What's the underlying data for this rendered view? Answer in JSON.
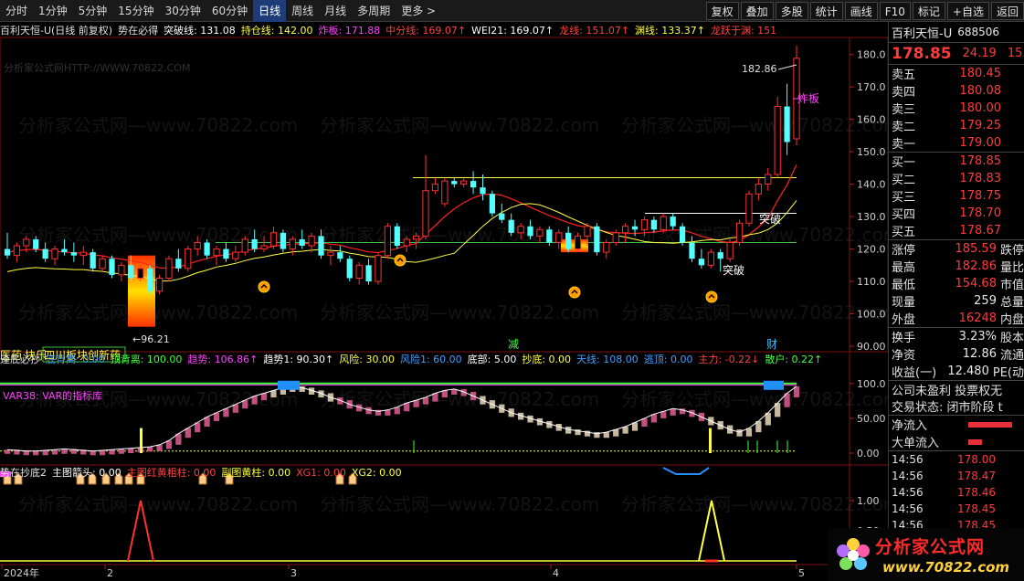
{
  "toolbar": {
    "periods": [
      "分时",
      "1分钟",
      "5分钟",
      "15分钟",
      "30分钟",
      "60分钟",
      "日线",
      "周线",
      "月线",
      "多周期",
      "更多 >"
    ],
    "active_period": "日线",
    "buttons": [
      "复权",
      "叠加",
      "多股",
      "统计",
      "画线",
      "F10",
      "标记",
      "+自选",
      "返回"
    ]
  },
  "main_header": {
    "stock": "百利天恒-U(日线 前复权)",
    "indicator": "势在必得",
    "items": [
      {
        "label": "突破线: 131.08",
        "color": "#ffffff"
      },
      {
        "label": "持仓线: 142.00",
        "color": "#ffff40"
      },
      {
        "label": "炸板: 171.88",
        "color": "#ff40ff"
      },
      {
        "label": "中分线: 169.07↑",
        "color": "#ff4040"
      },
      {
        "label": "WEI21: 169.07↑",
        "color": "#ffffff"
      },
      {
        "label": "龙线: 151.07↑",
        "color": "#ff4040"
      },
      {
        "label": "渊线: 133.37↑",
        "color": "#ffff40"
      },
      {
        "label": "龙跃于渊: 151",
        "color": "#ff4040"
      }
    ]
  },
  "price_axis": [
    "180.0",
    "170.0",
    "160.0",
    "150.0",
    "140.0",
    "130.0",
    "120.0",
    "110.0",
    "100.0",
    "90.00"
  ],
  "annotations": {
    "high_label": "182.86",
    "low_label": "96.21",
    "breakout1": "突破",
    "breakout2": "突破",
    "limit_break": "炸板",
    "sector1": "医药",
    "sector2": "块乐",
    "sector3": "四川板块创新药",
    "watermark": "分析家公式网",
    "watermark_url": "分析家公式网HTTP://WWW.70822.COM",
    "jian": "减",
    "cai": "财"
  },
  "sub1_header": {
    "name": "逢底必抄",
    "items": [
      {
        "label": "底背离: 0.00",
        "color": "#40a0ff"
      },
      {
        "label": "顶背离: 100.00",
        "color": "#40ff40"
      },
      {
        "label": "趋势: 106.86↑",
        "color": "#ff40ff"
      },
      {
        "label": "趋势1: 90.30↑",
        "color": "#ffffff"
      },
      {
        "label": "风险: 30.00",
        "color": "#ffff40"
      },
      {
        "label": "风险1: 60.00",
        "color": "#40a0ff"
      },
      {
        "label": "底部: 5.00",
        "color": "#ffffff"
      },
      {
        "label": "抄底: 0.00",
        "color": "#ffff40"
      },
      {
        "label": "天线: 108.00",
        "color": "#40a0ff"
      },
      {
        "label": "逃顶: 0.00",
        "color": "#40a0ff"
      },
      {
        "label": "主力: -0.22↓",
        "color": "#ff4040"
      },
      {
        "label": "散户: 0.22↑",
        "color": "#40ff40"
      }
    ],
    "var_label": "VAR38: VAR的指标库",
    "axis": [
      "100.0",
      "50.00",
      "0.00"
    ]
  },
  "sub2_header": {
    "name": "势在抄底2",
    "items": [
      {
        "label": "主图箭头: 0.00",
        "color": "#ffffff"
      },
      {
        "label": "主图红黄粗柱: 0.00",
        "color": "#ff4040"
      },
      {
        "label": "副图黄柱: 0.00",
        "color": "#ffff40"
      },
      {
        "label": "XG1: 0.00",
        "color": "#ff4040"
      },
      {
        "label": "XG2: 0.00",
        "color": "#ffff40"
      }
    ],
    "axis": [
      "1.00",
      "0.50",
      "0.00"
    ]
  },
  "x_axis": [
    "2024年",
    "2",
    "3",
    "4",
    "5"
  ],
  "right_panel": {
    "name": "百利天恒-U",
    "code": "688506",
    "price": "178.85",
    "change": "24.19",
    "pct": "15.64",
    "sells": [
      {
        "label": "卖五",
        "value": "180.45"
      },
      {
        "label": "卖四",
        "value": "180.08"
      },
      {
        "label": "卖三",
        "value": "180.00"
      },
      {
        "label": "卖二",
        "value": "179.25"
      },
      {
        "label": "卖一",
        "value": "179.00"
      }
    ],
    "buys": [
      {
        "label": "买一",
        "value": "178.85"
      },
      {
        "label": "买二",
        "value": "178.83"
      },
      {
        "label": "买三",
        "value": "178.75"
      },
      {
        "label": "买四",
        "value": "178.70"
      },
      {
        "label": "买五",
        "value": "178.67"
      }
    ],
    "stats1": [
      {
        "label": "涨停",
        "value": "185.59",
        "extra": "跌停",
        "white": false
      },
      {
        "label": "最高",
        "value": "182.86",
        "extra": "量比",
        "white": false
      },
      {
        "label": "最低",
        "value": "154.68",
        "extra": "市值",
        "white": false
      },
      {
        "label": "现量",
        "value": "259",
        "extra": "总量",
        "white": true
      },
      {
        "label": "外盘",
        "value": "16248",
        "extra": "内盘",
        "white": false
      }
    ],
    "stats2": [
      {
        "label": "换手",
        "value": "3.23%",
        "extra": "股本",
        "white": true
      },
      {
        "label": "净资",
        "value": "12.86",
        "extra": "流通",
        "white": true
      },
      {
        "label": "收益(一)",
        "value": "12.480",
        "extra": "PE(动",
        "white": true
      }
    ],
    "info1": "公司未盈利 投票权无",
    "info2": "交易状态: 闭市阶段 t",
    "flows": [
      {
        "label": "净流入",
        "ratio": 0.8
      },
      {
        "label": "大单流入",
        "ratio": 0.25
      }
    ],
    "ticks": [
      {
        "time": "14:56",
        "value": "178.00"
      },
      {
        "time": "14:56",
        "value": "178.47"
      },
      {
        "time": "14:56",
        "value": "178.46"
      },
      {
        "time": "14:56",
        "value": "178.45"
      },
      {
        "time": "14:56",
        "value": "178.45"
      },
      {
        "time": "14:56",
        "value": "178.85"
      }
    ]
  },
  "chart_data": {
    "type": "candlestick",
    "ylim": [
      90,
      185
    ],
    "candles": [
      [
        120,
        125,
        117,
        118
      ],
      [
        118,
        122,
        116,
        121
      ],
      [
        121,
        124,
        119,
        123
      ],
      [
        123,
        124,
        119,
        120
      ],
      [
        120,
        122,
        116,
        117
      ],
      [
        117,
        121,
        115,
        120
      ],
      [
        120,
        123,
        118,
        119
      ],
      [
        119,
        122,
        116,
        118
      ],
      [
        118,
        121,
        115,
        119
      ],
      [
        119,
        120,
        113,
        114
      ],
      [
        114,
        118,
        113,
        117
      ],
      [
        117,
        118,
        111,
        112
      ],
      [
        112,
        116,
        110,
        115
      ],
      [
        115,
        118,
        110,
        111
      ],
      [
        111,
        115,
        110,
        114
      ],
      [
        114,
        115,
        106,
        107
      ],
      [
        107,
        112,
        106,
        111
      ],
      [
        111,
        118,
        110,
        117
      ],
      [
        117,
        120,
        113,
        114
      ],
      [
        114,
        121,
        113,
        120
      ],
      [
        120,
        124,
        118,
        122
      ],
      [
        122,
        123,
        117,
        118
      ],
      [
        118,
        121,
        115,
        120
      ],
      [
        120,
        122,
        116,
        117
      ],
      [
        117,
        121,
        116,
        119
      ],
      [
        119,
        124,
        118,
        123
      ],
      [
        123,
        126,
        119,
        120
      ],
      [
        120,
        124,
        119,
        121
      ],
      [
        121,
        127,
        120,
        125
      ],
      [
        125,
        126,
        119,
        120
      ],
      [
        120,
        124,
        118,
        123
      ],
      [
        123,
        126,
        120,
        121
      ],
      [
        121,
        125,
        119,
        124
      ],
      [
        124,
        126,
        117,
        118
      ],
      [
        118,
        121,
        115,
        119
      ],
      [
        119,
        121,
        116,
        117
      ],
      [
        117,
        118,
        110,
        111
      ],
      [
        111,
        116,
        109,
        115
      ],
      [
        115,
        117,
        109,
        110
      ],
      [
        110,
        119,
        109,
        118
      ],
      [
        118,
        128,
        117,
        127
      ],
      [
        127,
        128,
        120,
        121
      ],
      [
        121,
        124,
        119,
        123
      ],
      [
        123,
        125,
        120,
        124
      ],
      [
        124,
        149,
        123,
        138
      ],
      [
        138,
        142,
        137,
        140
      ],
      [
        134,
        142,
        133,
        141
      ],
      [
        141,
        142,
        139,
        140
      ],
      [
        140,
        142,
        139,
        141
      ],
      [
        141,
        144,
        137,
        139
      ],
      [
        139,
        143,
        135,
        137
      ],
      [
        137,
        138,
        130,
        131
      ],
      [
        131,
        134,
        128,
        129
      ],
      [
        129,
        131,
        124,
        125
      ],
      [
        125,
        128,
        123,
        127
      ],
      [
        127,
        129,
        123,
        124
      ],
      [
        124,
        127,
        122,
        126
      ],
      [
        126,
        127,
        121,
        122
      ],
      [
        122,
        126,
        120,
        125
      ],
      [
        125,
        127,
        119,
        120
      ],
      [
        120,
        125,
        119,
        124
      ],
      [
        124,
        128,
        121,
        127
      ],
      [
        127,
        128,
        118,
        119
      ],
      [
        119,
        123,
        117,
        122
      ],
      [
        122,
        126,
        121,
        125
      ],
      [
        125,
        128,
        122,
        127
      ],
      [
        127,
        129,
        124,
        126
      ],
      [
        126,
        130,
        124,
        129
      ],
      [
        129,
        130,
        125,
        126
      ],
      [
        126,
        131,
        125,
        130
      ],
      [
        130,
        131,
        126,
        127
      ],
      [
        127,
        128,
        121,
        122
      ],
      [
        122,
        124,
        116,
        117
      ],
      [
        117,
        120,
        114,
        115
      ],
      [
        115,
        120,
        114,
        119
      ],
      [
        119,
        120,
        113,
        117
      ],
      [
        117,
        123,
        116,
        122
      ],
      [
        122,
        129,
        121,
        128
      ],
      [
        128,
        138,
        127,
        137
      ],
      [
        137,
        142,
        135,
        140
      ],
      [
        140,
        145,
        138,
        143
      ],
      [
        143,
        167,
        142,
        164
      ],
      [
        164,
        171,
        149,
        153
      ],
      [
        154,
        182.86,
        152,
        178.85
      ]
    ],
    "ma_red": [
      119,
      119.5,
      119.8,
      119.9,
      119.6,
      119.3,
      119.1,
      118.8,
      118.7,
      118.2,
      117.9,
      117.3,
      116.9,
      116.3,
      115.9,
      115,
      114.2,
      114.1,
      114.5,
      115.3,
      116.3,
      117,
      117.8,
      118.2,
      118.7,
      119.4,
      120,
      120.3,
      120.8,
      121.2,
      121.5,
      121.6,
      121.8,
      121.9,
      121.5,
      121.2,
      120.4,
      119.8,
      119.1,
      118.9,
      119.5,
      120.2,
      121,
      121.7,
      124.5,
      127.2,
      130,
      132.4,
      134.3,
      135.8,
      136.8,
      137,
      136.6,
      135.5,
      134.3,
      132.9,
      131.6,
      130.3,
      129.2,
      128.1,
      127.2,
      126.7,
      126,
      125.3,
      125,
      124.9,
      124.8,
      125,
      125.2,
      125.6,
      125.9,
      125.8,
      125,
      123.9,
      123.2,
      122.3,
      122,
      122.6,
      124.4,
      126.8,
      129.5,
      135,
      139.8,
      146
    ]
  },
  "sub1_data": {
    "bars": [
      5,
      4,
      3,
      3,
      4,
      5,
      6,
      5,
      4,
      3,
      4,
      5,
      6,
      7,
      8,
      9,
      12,
      18,
      28,
      36,
      44,
      52,
      58,
      64,
      70,
      76,
      82,
      86,
      90,
      94,
      96,
      94,
      90,
      86,
      80,
      76,
      70,
      66,
      62,
      60,
      62,
      66,
      72,
      76,
      80,
      86,
      90,
      92,
      88,
      82,
      76,
      70,
      64,
      58,
      54,
      50,
      46,
      42,
      38,
      34,
      32,
      30,
      28,
      30,
      34,
      38,
      44,
      50,
      56,
      60,
      64,
      62,
      58,
      52,
      46,
      40,
      34,
      30,
      36,
      46,
      58,
      72,
      86,
      96,
      100,
      102,
      104
    ],
    "colors": "pppppppppppppppppppppppppppptttttttppppppppppppppptttttttttttttttttpppppppttttttttpppppppppp"
  }
}
